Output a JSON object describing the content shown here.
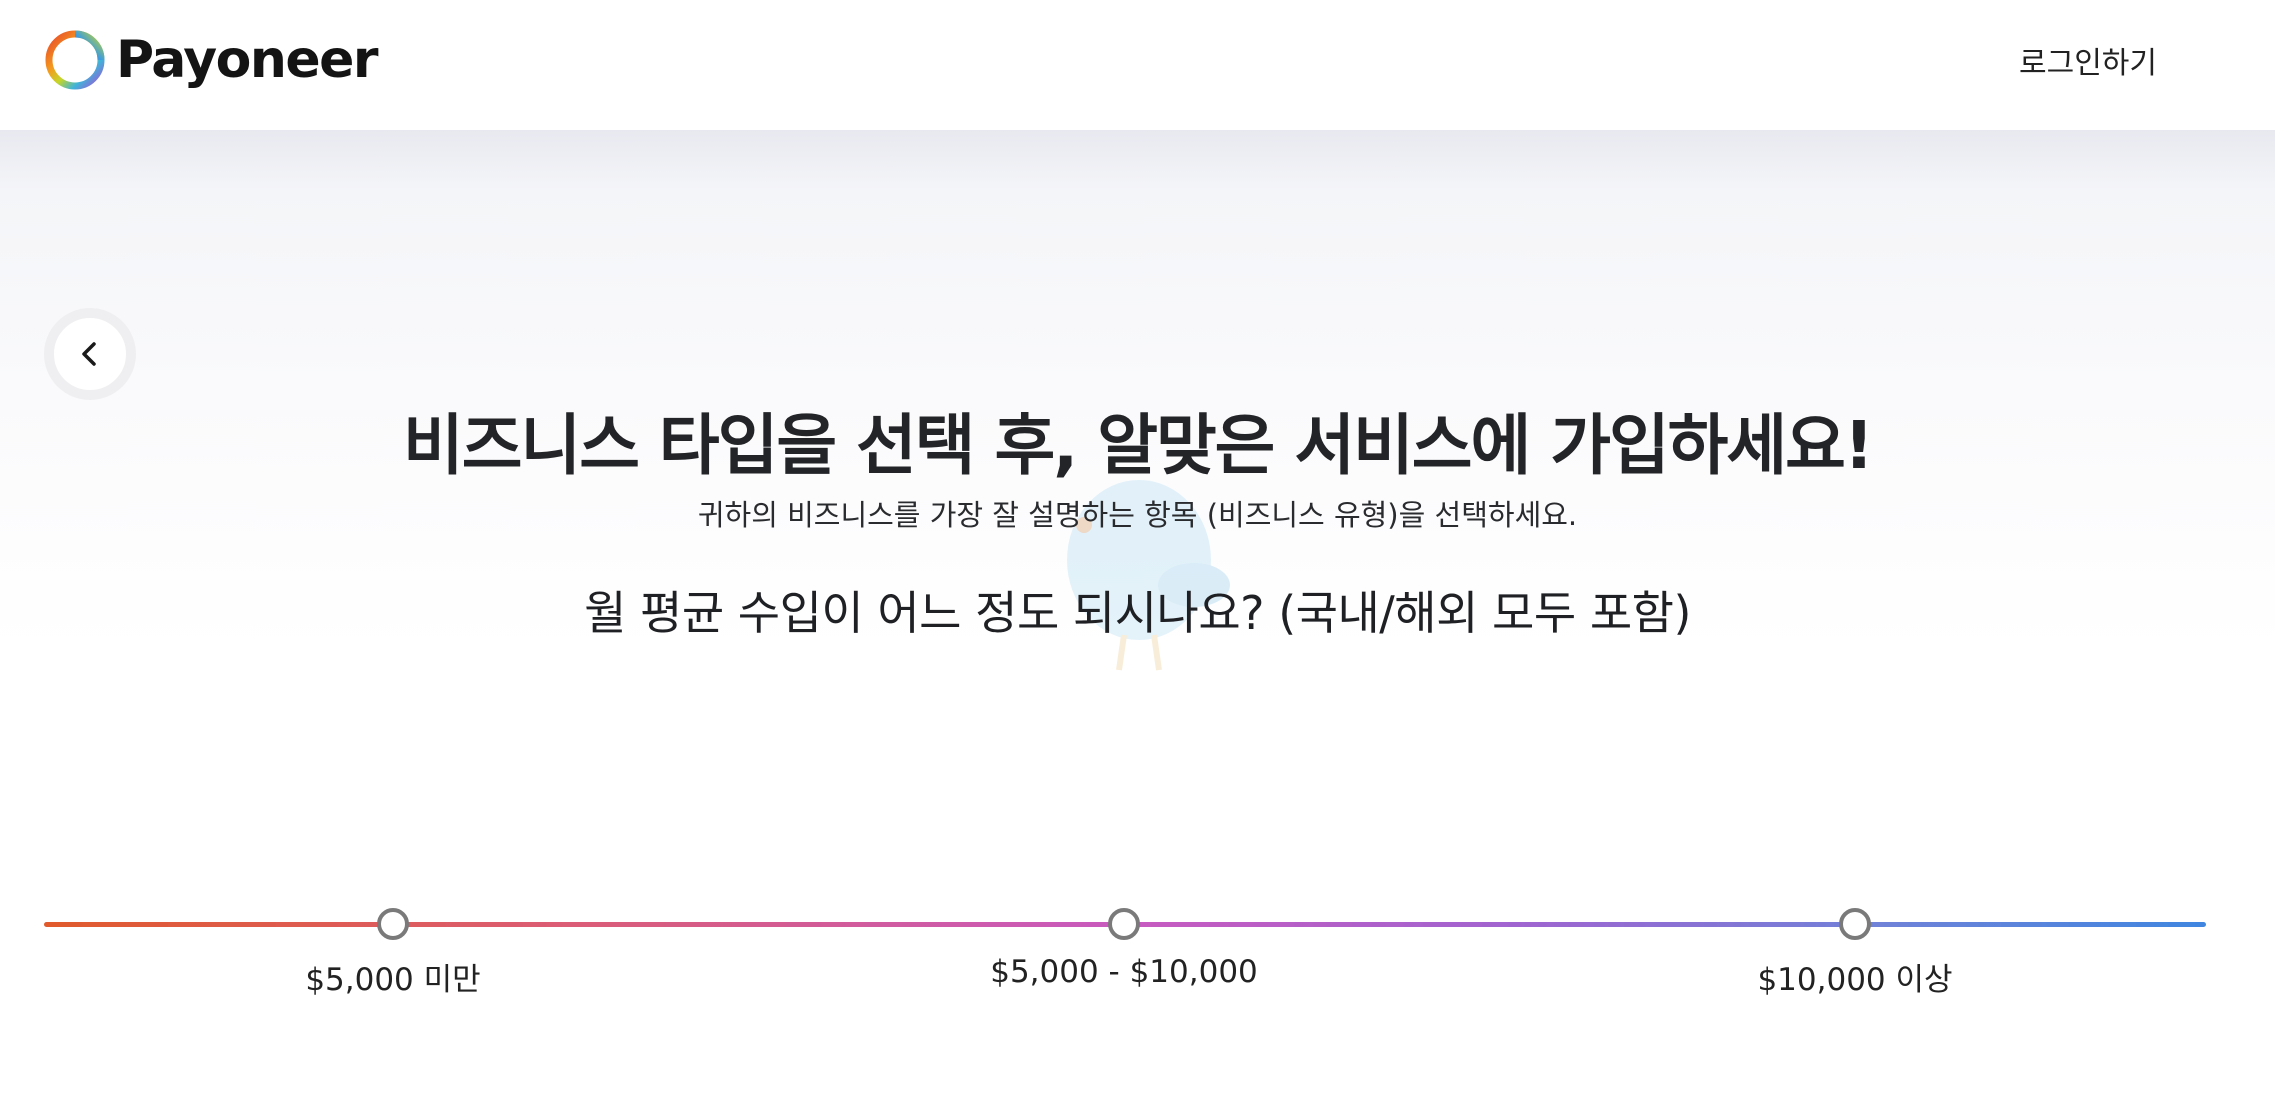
{
  "header": {
    "logo_text": "Payoneer",
    "login_label": "로그인하기"
  },
  "main": {
    "title": "비즈니스 타입을 선택 후, 알맞은 서비스에 가입하세요!",
    "subtitle": "귀하의 비즈니스를 가장 잘 설명하는 항목 (비즈니스 유형)을 선택하세요.",
    "question": "월 평균 수입이 어느 정도 되시나요? (국내/해외 모두 포함)"
  },
  "slider": {
    "options": [
      {
        "label": "$5,000 미만"
      },
      {
        "label": "$5,000 - $10,000"
      },
      {
        "label": "$10,000 이상"
      }
    ],
    "selected": null
  },
  "icons": {
    "back": "chevron-left-icon",
    "logo": "payoneer-ring-logo"
  },
  "colors": {
    "track_start": "#e05a2c",
    "track_mid": "#c85ac0",
    "track_end": "#3f86e0",
    "stop_border": "#7a7a7a"
  }
}
